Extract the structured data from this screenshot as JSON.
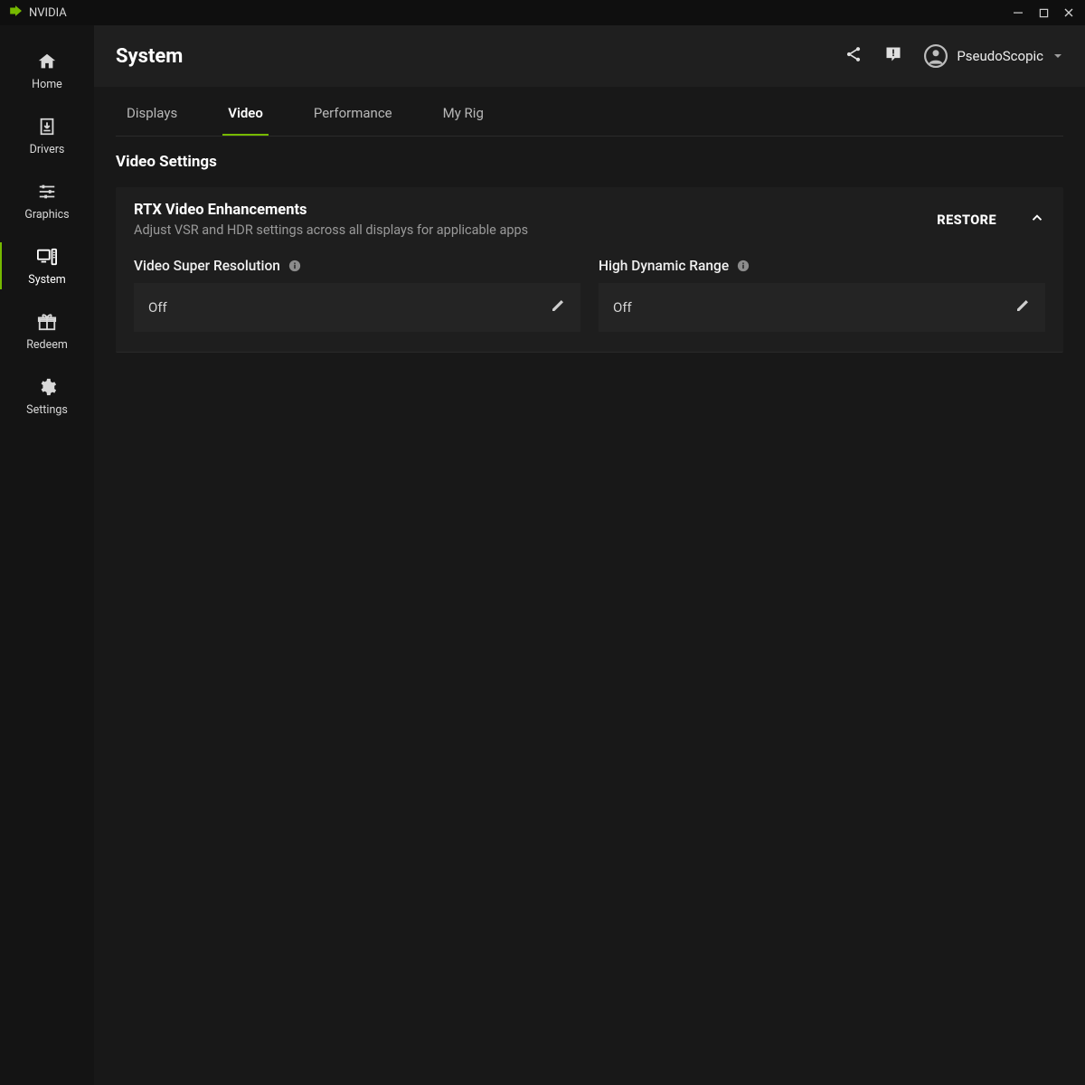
{
  "titlebar": {
    "brand": "NVIDIA"
  },
  "sidebar": {
    "items": [
      {
        "key": "home",
        "label": "Home"
      },
      {
        "key": "drivers",
        "label": "Drivers"
      },
      {
        "key": "graphics",
        "label": "Graphics"
      },
      {
        "key": "system",
        "label": "System"
      },
      {
        "key": "redeem",
        "label": "Redeem"
      },
      {
        "key": "settings",
        "label": "Settings"
      }
    ],
    "active": "system"
  },
  "header": {
    "title": "System",
    "user_name": "PseudoScopic"
  },
  "tabs": {
    "items": [
      {
        "key": "displays",
        "label": "Displays"
      },
      {
        "key": "video",
        "label": "Video"
      },
      {
        "key": "performance",
        "label": "Performance"
      },
      {
        "key": "myrig",
        "label": "My Rig"
      }
    ],
    "active": "video"
  },
  "section": {
    "title": "Video Settings"
  },
  "panel": {
    "title": "RTX Video Enhancements",
    "subtitle": "Adjust VSR and HDR settings across all displays for applicable apps",
    "restore_label": "RESTORE",
    "settings": [
      {
        "key": "vsr",
        "label": "Video Super Resolution",
        "value": "Off"
      },
      {
        "key": "hdr",
        "label": "High Dynamic Range",
        "value": "Off"
      }
    ]
  },
  "colors": {
    "accent": "#76b900",
    "bg": "#181818",
    "panel": "#1e1e1e"
  }
}
